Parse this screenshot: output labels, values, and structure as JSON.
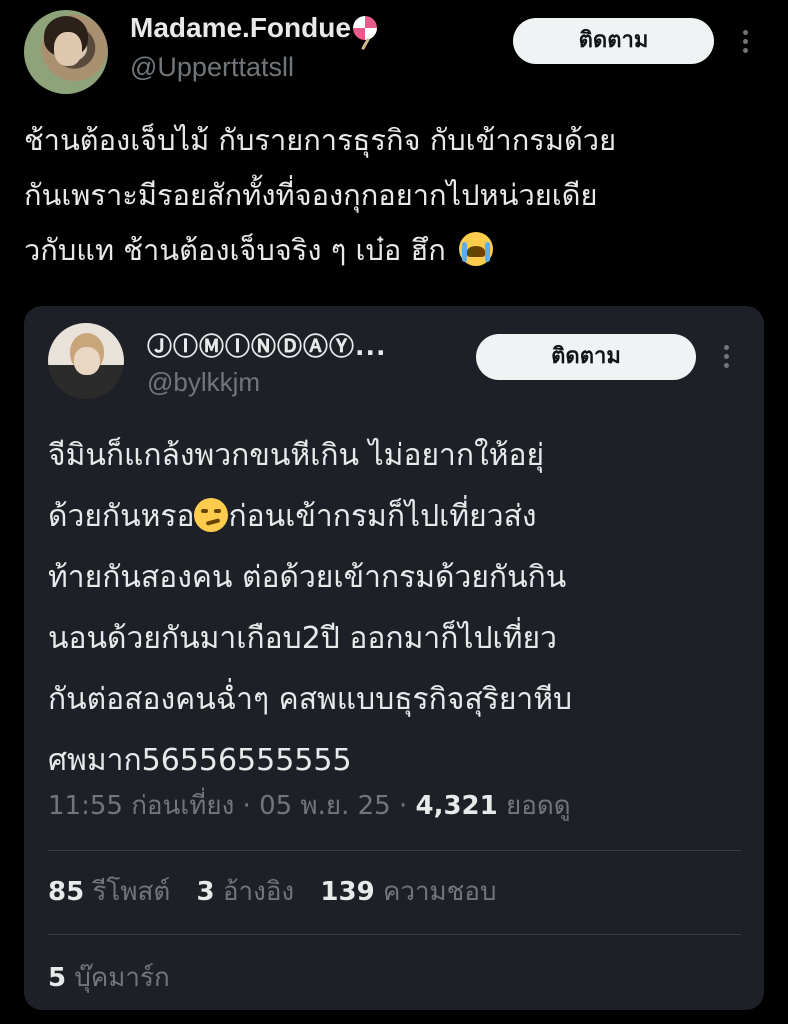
{
  "tweet": {
    "display_name": "Madame.Fondue",
    "handle": "@Upperttatsll",
    "follow_label": "ติดตาม",
    "text_lines": [
      "ช้านต้องเจ็บไม้ กับรายการธุรกิจ กับเข้ากรมด้วย",
      "กันเพราะมีรอยสักทั้งที่จองกุกอยากไปหน่วยเดีย",
      "วกับแท ช้านต้องเจ็บจริง ๆ เบ๋อ ฮึก"
    ],
    "emoji": "loudly-crying-face"
  },
  "quoted": {
    "display_name": "ⒿⒾⓂⒾⓃⒹⒶⓎ...",
    "handle": "@bylkkjm",
    "follow_label": "ติดตาม",
    "text_lines": [
      "จีมินก็แกล้งพวกขนหีเกิน ไม่อยากให้อยุ่",
      "ด้วยกันหรอ",
      "ก่อนเข้ากรมก็ไปเที่ยวส่ง",
      "ท้ายกันสองคน ต่อด้วยเข้ากรมด้วยกันกิน",
      "นอนด้วยกันมาเกือบ2ปี ออกมาก็ไปเที่ยว",
      "กันต่อสองคนฉ่ำๆ คสพแบบธุรกิจสุริยาหีบ",
      "ศพมาก56556555555"
    ],
    "emoji": "smirking-face",
    "time": "11:55 ก่อนเที่ยง",
    "date": "05 พ.ย. 25",
    "views_count": "4,321",
    "views_label": "ยอดดู",
    "reposts_count": "85",
    "reposts_label": "รีโพสต์",
    "quotes_count": "3",
    "quotes_label": "อ้างอิง",
    "likes_count": "139",
    "likes_label": "ความชอบ",
    "bookmarks_count": "5",
    "bookmarks_label": "บุ๊คมาร์ก"
  },
  "colors": {
    "background": "#000000",
    "card": "#1e2027",
    "primary_text": "#e7e9ea",
    "secondary_text": "#71767b",
    "button_bg": "#eff3f4",
    "button_text": "#0f1419"
  }
}
